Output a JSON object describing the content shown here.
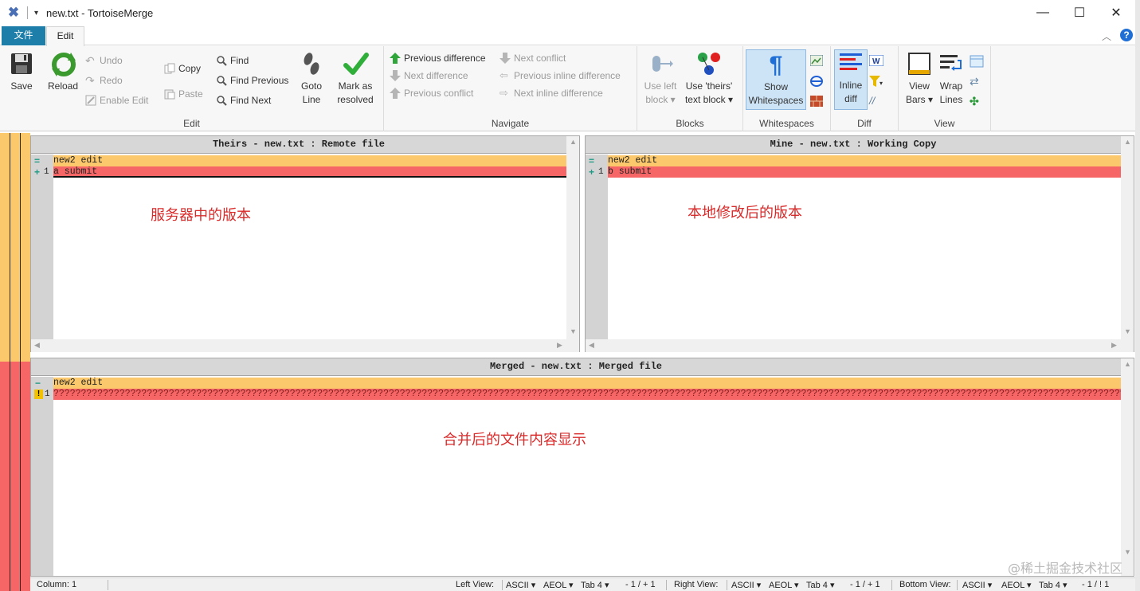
{
  "window": {
    "title": "new.txt - TortoiseMerge",
    "quick_access": "▾",
    "minimize": "—",
    "maximize": "☐",
    "close": "✕"
  },
  "ribbon_tabs": {
    "file": "文件",
    "edit": "Edit"
  },
  "ribbon": {
    "edit_group": {
      "label": "Edit",
      "save": "Save",
      "reload": "Reload",
      "undo": "Undo",
      "redo": "Redo",
      "enable_edit": "Enable Edit",
      "copy": "Copy",
      "paste": "Paste",
      "find": "Find",
      "find_previous": "Find Previous",
      "find_next": "Find Next",
      "goto_line_1": "Goto",
      "goto_line_2": "Line",
      "mark_resolved_1": "Mark as",
      "mark_resolved_2": "resolved"
    },
    "navigate_group": {
      "label": "Navigate",
      "previous_difference": "Previous difference",
      "next_difference": "Next difference",
      "previous_conflict": "Previous conflict",
      "next_conflict": "Next conflict",
      "previous_inline_difference": "Previous inline difference",
      "next_inline_difference": "Next inline difference"
    },
    "blocks_group": {
      "label": "Blocks",
      "use_left_1": "Use left",
      "use_left_2": "block",
      "use_theirs_1": "Use 'theirs'",
      "use_theirs_2": "text block"
    },
    "whitespaces_group": {
      "label": "Whitespaces",
      "show_ws_1": "Show",
      "show_ws_2": "Whitespaces"
    },
    "diff_group": {
      "label": "Diff",
      "inline_1": "Inline",
      "inline_2": "diff"
    },
    "view_group": {
      "label": "View",
      "view_bars_1": "View",
      "view_bars_2": "Bars",
      "wrap_1": "Wrap",
      "wrap_2": "Lines"
    }
  },
  "panes": {
    "theirs": {
      "header": "Theirs - new.txt : Remote file",
      "lines": [
        {
          "marker": "=",
          "num": "",
          "text": "new2 edit"
        },
        {
          "marker": "+",
          "num": "1",
          "text": "a submit"
        }
      ],
      "annotation": "服务器中的版本"
    },
    "mine": {
      "header": "Mine - new.txt : Working Copy",
      "lines": [
        {
          "marker": "=",
          "num": "",
          "text": "new2 edit"
        },
        {
          "marker": "+",
          "num": "1",
          "text": "b submit"
        }
      ],
      "annotation": "本地修改后的版本"
    },
    "merged": {
      "header": "Merged - new.txt : Merged file",
      "lines": [
        {
          "marker": "−",
          "num": "",
          "text": "new2 edit"
        },
        {
          "marker": "!",
          "num": "1",
          "text": "???????????????????????????????????????????????????????????????????????????????????????????????????????????????????????????????????????????????????????????????????????????????????????????????????????????????????????"
        }
      ],
      "annotation": "合并后的文件内容显示"
    }
  },
  "status": {
    "column": "Column: 1",
    "left_view": "Left View:",
    "left_enc": "ASCII",
    "left_eol": "AEOL",
    "left_tab": "Tab 4",
    "left_diff": "- 1 / + 1",
    "right_view": "Right View:",
    "right_enc": "ASCII",
    "right_eol": "AEOL",
    "right_tab": "Tab 4",
    "right_diff": "- 1 / + 1",
    "bottom_view": "Bottom View:",
    "bottom_enc": "ASCII",
    "bottom_eol": "AEOL",
    "bottom_tab": "Tab 4",
    "bottom_diff": "- 1 / ! 1"
  },
  "watermark": "@稀土掘金技术社区",
  "colors": {
    "equal_line": "#fbc86c",
    "changed_line": "#f76666",
    "file_tab": "#1d7fa9"
  }
}
